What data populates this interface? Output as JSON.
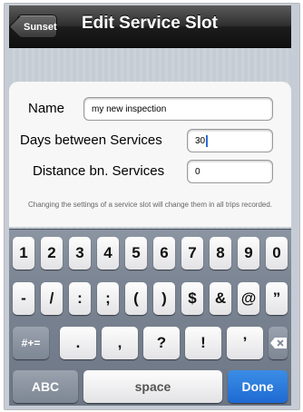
{
  "nav": {
    "back_label": "Sunset",
    "title": "Edit Service Slot"
  },
  "form": {
    "name_label": "Name",
    "name_value": "my new inspection",
    "days_label": "Days between Services",
    "days_value": "30",
    "distance_label": "Distance bn. Services",
    "distance_value": "0",
    "note": "Changing the settings of a service slot will change them in all trips recorded."
  },
  "keyboard": {
    "row1": [
      "1",
      "2",
      "3",
      "4",
      "5",
      "6",
      "7",
      "8",
      "9",
      "0"
    ],
    "row2": [
      "-",
      "/",
      ":",
      ";",
      "(",
      ")",
      "$",
      "&",
      "@",
      "”"
    ],
    "row3_left": "#+=",
    "row3": [
      ".",
      ",",
      "?",
      "!",
      "’"
    ],
    "abc": "ABC",
    "space": "space",
    "done": "Done"
  }
}
